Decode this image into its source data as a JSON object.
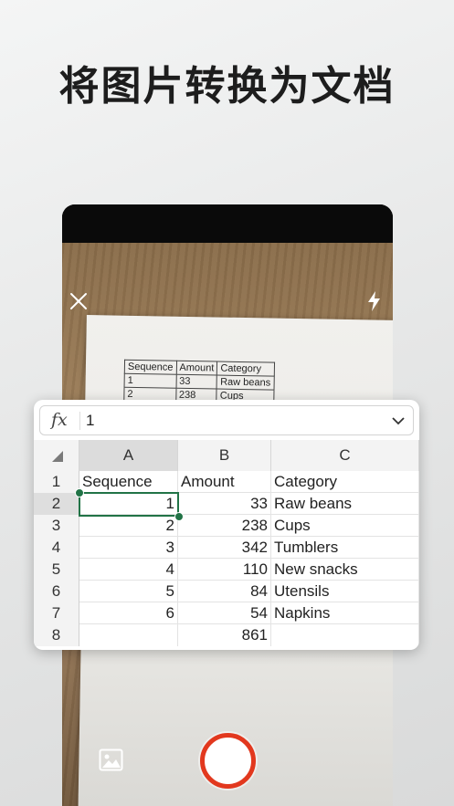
{
  "promo": {
    "title": "将图片转换为文档"
  },
  "camera": {
    "close_icon": "close-icon",
    "flash_icon": "flash-icon",
    "gallery_icon": "image-gallery-icon",
    "shutter_color": "#e2381e"
  },
  "printed_table": {
    "rows": [
      [
        "Sequence",
        "Amount",
        "Category"
      ],
      [
        "1",
        "33",
        "Raw beans"
      ],
      [
        "2",
        "238",
        "Cups"
      ]
    ]
  },
  "sheet": {
    "formula_label": "fx",
    "formula_value": "1",
    "columns": [
      "A",
      "B",
      "C"
    ],
    "rows": [
      {
        "num": "1",
        "a": "Sequence",
        "b": "Amount",
        "c": "Category"
      },
      {
        "num": "2",
        "a": "1",
        "b": "33",
        "c": "Raw beans"
      },
      {
        "num": "3",
        "a": "2",
        "b": "238",
        "c": "Cups"
      },
      {
        "num": "4",
        "a": "3",
        "b": "342",
        "c": "Tumblers"
      },
      {
        "num": "5",
        "a": "4",
        "b": "110",
        "c": "New snacks"
      },
      {
        "num": "6",
        "a": "5",
        "b": "84",
        "c": "Utensils"
      },
      {
        "num": "7",
        "a": "6",
        "b": "54",
        "c": "Napkins"
      },
      {
        "num": "8",
        "a": "",
        "b": "861",
        "c": ""
      }
    ],
    "selected_cell": "A2",
    "accent_color": "#217346"
  }
}
